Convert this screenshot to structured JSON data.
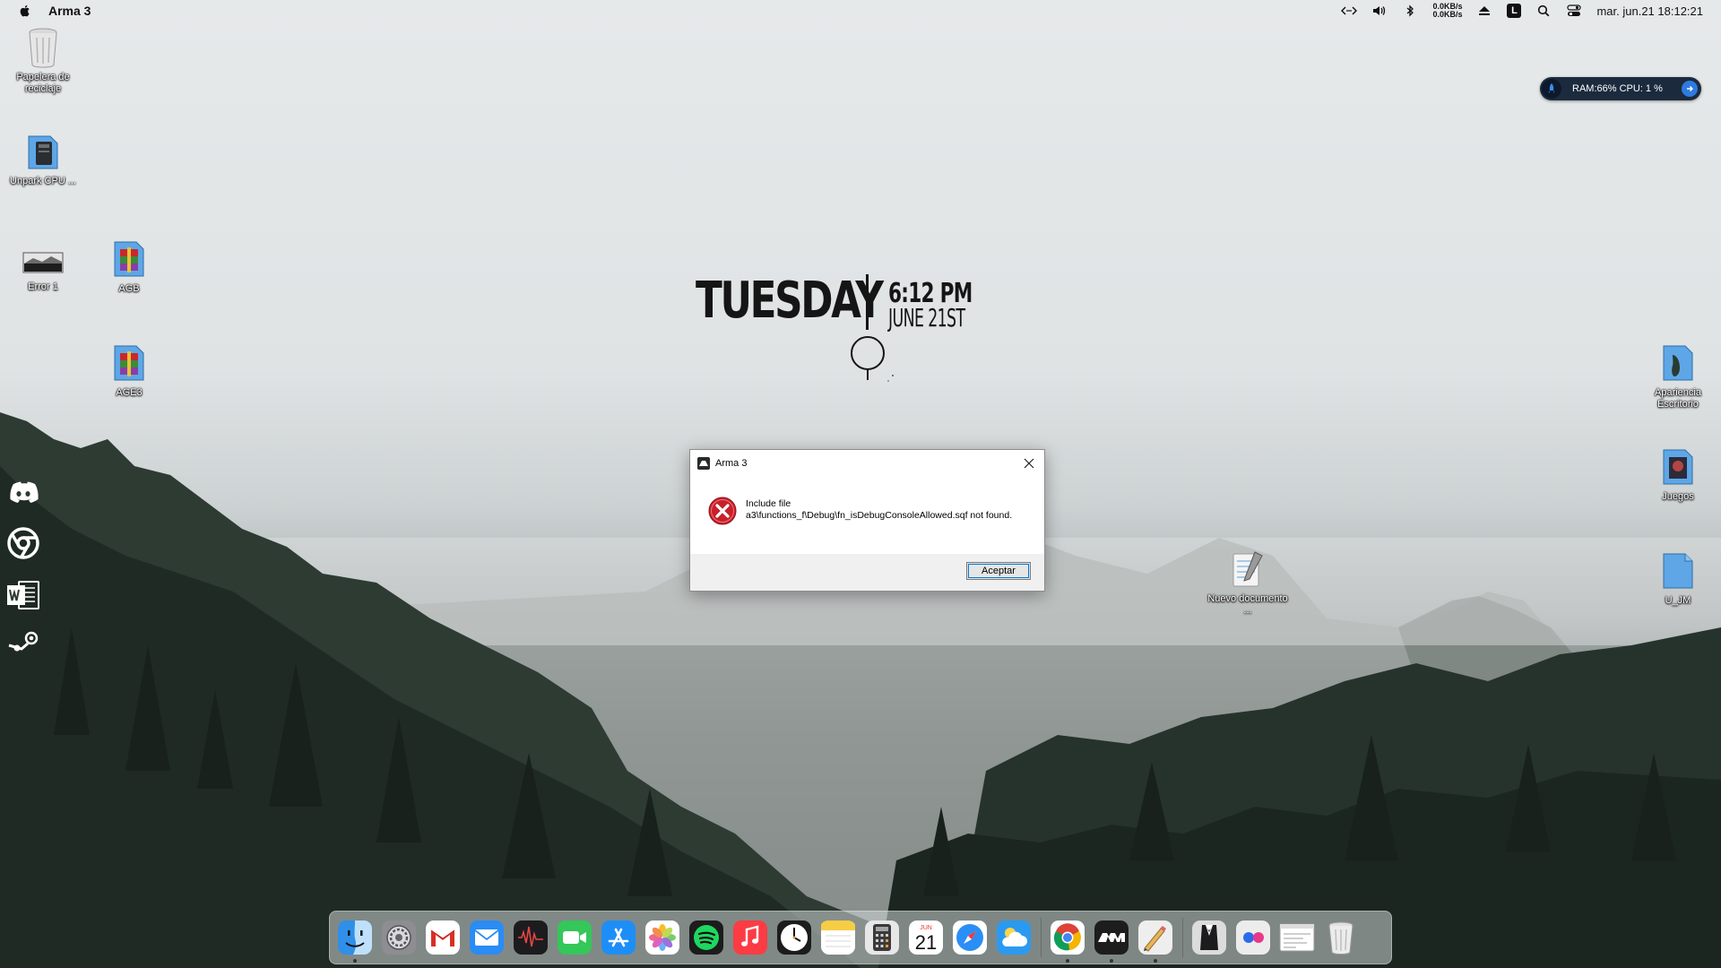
{
  "menubar": {
    "app_name": "Arma 3",
    "net_up": "0.0KB/s",
    "net_down": "0.0KB/s",
    "l_badge": "L",
    "datetime": "mar. jun.21  18:12:21"
  },
  "ram_widget": {
    "text": "RAM:66%   CPU: 1 %"
  },
  "desktop_icons": [
    {
      "label": "Papelera de reciclaje"
    },
    {
      "label": "Unpark CPU ..."
    },
    {
      "label": "Error 1"
    },
    {
      "label": "AGB"
    },
    {
      "label": "AGE3"
    },
    {
      "label": "Apariencia Escritorio"
    },
    {
      "label": "Juegos"
    },
    {
      "label": "U_JM"
    },
    {
      "label": "Nuevo documento ..."
    }
  ],
  "clock_widget": {
    "day": "TUESDAY",
    "time": "6:12 PM",
    "date": "JUNE 21ST"
  },
  "dialog": {
    "title": "Arma 3",
    "message_line1": "Include file",
    "message_line2": "a3\\functions_f\\Debug\\fn_isDebugConsoleAllowed.sqf not found.",
    "ok_label": "Aceptar"
  },
  "dock": {
    "calendar_month": "JUN",
    "calendar_day": "21"
  },
  "colors": {
    "accent_blue": "#2e7be0",
    "error_red": "#c8202a",
    "widget_bg": "#1c2a3e"
  }
}
